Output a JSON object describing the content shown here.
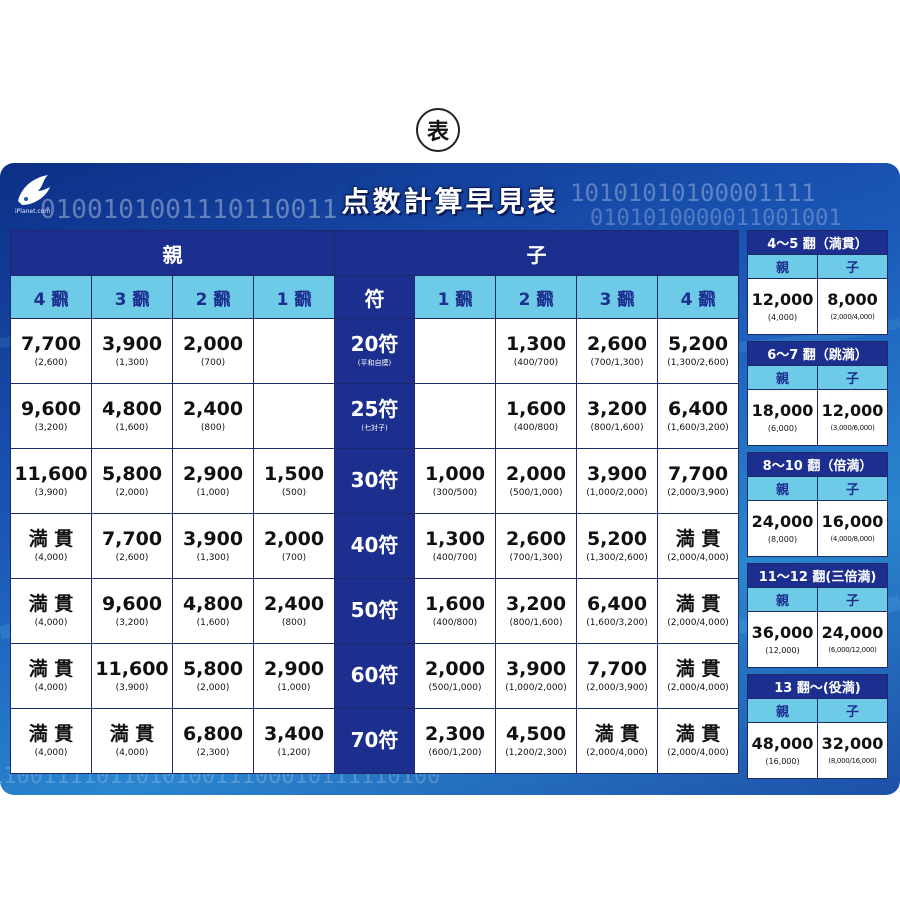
{
  "badge": "表",
  "title": "点数計算早見表",
  "logo_text": "iPlanet.com",
  "colors": {
    "navy": "#1c2f8f",
    "cyan_header": "#6ecbe8",
    "board_blue": "#1b58b8"
  },
  "main": {
    "dealer_label": "親",
    "child_label": "子",
    "fu_label": "符",
    "dealer_han": [
      "4 飜",
      "3 飜",
      "2 飜",
      "1 飜"
    ],
    "child_han": [
      "1 飜",
      "2 飜",
      "3 飜",
      "4 飜"
    ],
    "rows": [
      {
        "fu": "20符",
        "fu_note": "(平和自摸)",
        "dealer": [
          {
            "v": "7,700",
            "s": "(2,600)"
          },
          {
            "v": "3,900",
            "s": "(1,300)"
          },
          {
            "v": "2,000",
            "s": "(700)"
          },
          {
            "v": "",
            "s": ""
          }
        ],
        "child": [
          {
            "v": "",
            "s": ""
          },
          {
            "v": "1,300",
            "s": "(400/700)"
          },
          {
            "v": "2,600",
            "s": "(700/1,300)"
          },
          {
            "v": "5,200",
            "s": "(1,300/2,600)"
          }
        ]
      },
      {
        "fu": "25符",
        "fu_note": "(七対子)",
        "dealer": [
          {
            "v": "9,600",
            "s": "(3,200)"
          },
          {
            "v": "4,800",
            "s": "(1,600)"
          },
          {
            "v": "2,400",
            "s": "(800)"
          },
          {
            "v": "",
            "s": ""
          }
        ],
        "child": [
          {
            "v": "",
            "s": ""
          },
          {
            "v": "1,600",
            "s": "(400/800)"
          },
          {
            "v": "3,200",
            "s": "(800/1,600)"
          },
          {
            "v": "6,400",
            "s": "(1,600/3,200)"
          }
        ]
      },
      {
        "fu": "30符",
        "fu_note": "",
        "dealer": [
          {
            "v": "11,600",
            "s": "(3,900)"
          },
          {
            "v": "5,800",
            "s": "(2,000)"
          },
          {
            "v": "2,900",
            "s": "(1,000)"
          },
          {
            "v": "1,500",
            "s": "(500)"
          }
        ],
        "child": [
          {
            "v": "1,000",
            "s": "(300/500)"
          },
          {
            "v": "2,000",
            "s": "(500/1,000)"
          },
          {
            "v": "3,900",
            "s": "(1,000/2,000)"
          },
          {
            "v": "7,700",
            "s": "(2,000/3,900)"
          }
        ]
      },
      {
        "fu": "40符",
        "fu_note": "",
        "dealer": [
          {
            "v": "満 貫",
            "s": "(4,000)"
          },
          {
            "v": "7,700",
            "s": "(2,600)"
          },
          {
            "v": "3,900",
            "s": "(1,300)"
          },
          {
            "v": "2,000",
            "s": "(700)"
          }
        ],
        "child": [
          {
            "v": "1,300",
            "s": "(400/700)"
          },
          {
            "v": "2,600",
            "s": "(700/1,300)"
          },
          {
            "v": "5,200",
            "s": "(1,300/2,600)"
          },
          {
            "v": "満 貫",
            "s": "(2,000/4,000)"
          }
        ]
      },
      {
        "fu": "50符",
        "fu_note": "",
        "dealer": [
          {
            "v": "満 貫",
            "s": "(4,000)"
          },
          {
            "v": "9,600",
            "s": "(3,200)"
          },
          {
            "v": "4,800",
            "s": "(1,600)"
          },
          {
            "v": "2,400",
            "s": "(800)"
          }
        ],
        "child": [
          {
            "v": "1,600",
            "s": "(400/800)"
          },
          {
            "v": "3,200",
            "s": "(800/1,600)"
          },
          {
            "v": "6,400",
            "s": "(1,600/3,200)"
          },
          {
            "v": "満 貫",
            "s": "(2,000/4,000)"
          }
        ]
      },
      {
        "fu": "60符",
        "fu_note": "",
        "dealer": [
          {
            "v": "満 貫",
            "s": "(4,000)"
          },
          {
            "v": "11,600",
            "s": "(3,900)"
          },
          {
            "v": "5,800",
            "s": "(2,000)"
          },
          {
            "v": "2,900",
            "s": "(1,000)"
          }
        ],
        "child": [
          {
            "v": "2,000",
            "s": "(500/1,000)"
          },
          {
            "v": "3,900",
            "s": "(1,000/2,000)"
          },
          {
            "v": "7,700",
            "s": "(2,000/3,900)"
          },
          {
            "v": "満 貫",
            "s": "(2,000/4,000)"
          }
        ]
      },
      {
        "fu": "70符",
        "fu_note": "",
        "dealer": [
          {
            "v": "満 貫",
            "s": "(4,000)"
          },
          {
            "v": "満 貫",
            "s": "(4,000)"
          },
          {
            "v": "6,800",
            "s": "(2,300)"
          },
          {
            "v": "3,400",
            "s": "(1,200)"
          }
        ],
        "child": [
          {
            "v": "2,300",
            "s": "(600/1,200)"
          },
          {
            "v": "4,500",
            "s": "(1,200/2,300)"
          },
          {
            "v": "満 貫",
            "s": "(2,000/4,000)"
          },
          {
            "v": "満 貫",
            "s": "(2,000/4,000)"
          }
        ]
      }
    ]
  },
  "side": [
    {
      "title": "4～5 翻（満貫）",
      "dealer_label": "親",
      "child_label": "子",
      "dealer_value": "12,000",
      "dealer_sub": "(4,000)",
      "child_value": "8,000",
      "child_sub": "(2,000/4,000)"
    },
    {
      "title": "6～7 翻（跳満）",
      "dealer_label": "親",
      "child_label": "子",
      "dealer_value": "18,000",
      "dealer_sub": "(6,000)",
      "child_value": "12,000",
      "child_sub": "(3,000/6,000)"
    },
    {
      "title": "8～10 翻（倍満）",
      "dealer_label": "親",
      "child_label": "子",
      "dealer_value": "24,000",
      "dealer_sub": "(8,000)",
      "child_value": "16,000",
      "child_sub": "(4,000/8,000)"
    },
    {
      "title": "11～12 翻(三倍満)",
      "dealer_label": "親",
      "child_label": "子",
      "dealer_value": "36,000",
      "dealer_sub": "(12,000)",
      "child_value": "24,000",
      "child_sub": "(6,000/12,000)"
    },
    {
      "title": "13 翻～(役満)",
      "dealer_label": "親",
      "child_label": "子",
      "dealer_value": "48,000",
      "dealer_sub": "(16,000)",
      "child_value": "32,000",
      "child_sub": "(8,000/16,000)"
    }
  ]
}
